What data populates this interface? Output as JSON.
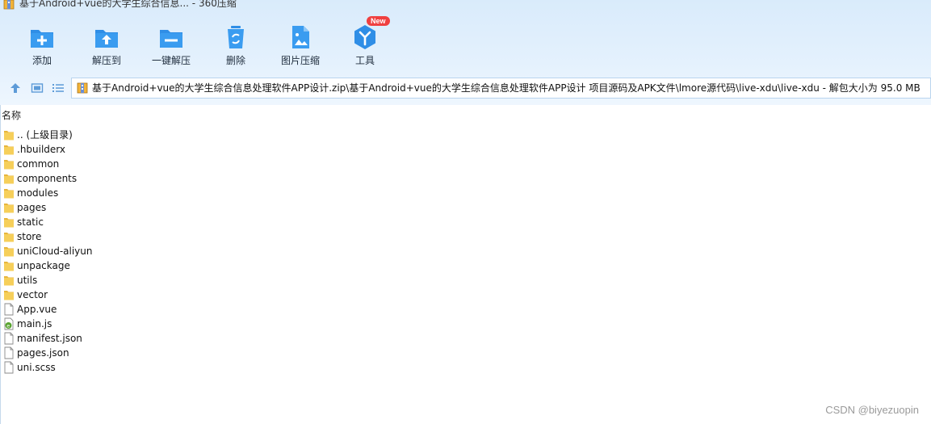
{
  "window": {
    "title": "基于Android+vue的大学生综合信息... - 360压缩"
  },
  "toolbar": {
    "items": [
      {
        "label": "添加",
        "icon": "add-folder-icon"
      },
      {
        "label": "解压到",
        "icon": "extract-to-icon"
      },
      {
        "label": "一键解压",
        "icon": "one-click-extract-icon"
      },
      {
        "label": "删除",
        "icon": "recycle-delete-icon"
      },
      {
        "label": "图片压缩",
        "icon": "image-compress-icon"
      },
      {
        "label": "工具",
        "icon": "tools-icon"
      }
    ],
    "new_badge": "New"
  },
  "address": {
    "path": "基于Android+vue的大学生综合信息处理软件APP设计.zip\\基于Android+vue的大学生综合信息处理软件APP设计 项目源码及APK文件\\lmore源代码\\live-xdu\\live-xdu - 解包大小为 95.0 MB"
  },
  "list": {
    "column_name": "名称",
    "items": [
      {
        "name": ".. (上级目录)",
        "type": "folder"
      },
      {
        "name": ".hbuilderx",
        "type": "folder"
      },
      {
        "name": "common",
        "type": "folder"
      },
      {
        "name": "components",
        "type": "folder"
      },
      {
        "name": "modules",
        "type": "folder"
      },
      {
        "name": "pages",
        "type": "folder"
      },
      {
        "name": "static",
        "type": "folder"
      },
      {
        "name": "store",
        "type": "folder"
      },
      {
        "name": "uniCloud-aliyun",
        "type": "folder"
      },
      {
        "name": "unpackage",
        "type": "folder"
      },
      {
        "name": "utils",
        "type": "folder"
      },
      {
        "name": "vector",
        "type": "folder"
      },
      {
        "name": "App.vue",
        "type": "file"
      },
      {
        "name": "main.js",
        "type": "js"
      },
      {
        "name": "manifest.json",
        "type": "file"
      },
      {
        "name": "pages.json",
        "type": "file"
      },
      {
        "name": "uni.scss",
        "type": "file"
      }
    ]
  },
  "watermark": "CSDN @biyezuopin",
  "colors": {
    "accent": "#2f8ee6",
    "folder": "#f6cf5a",
    "badge": "#f04040"
  }
}
